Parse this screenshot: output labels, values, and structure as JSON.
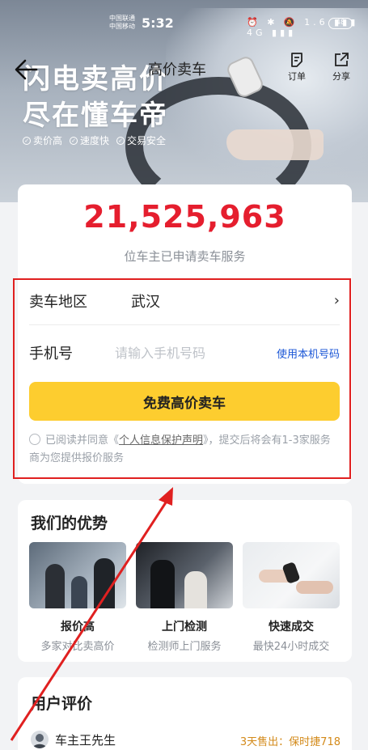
{
  "status_bar": {
    "carrier_1": "中国联通",
    "carrier_2": "中国移动",
    "time": "5:32",
    "icons": "⏰ ✱ 🔕 1.6 ▮▮▮ 4G ▮▮▮",
    "battery": "48"
  },
  "hero": {
    "line1": "闪电卖高价",
    "line2": "尽在懂车帝",
    "badges": [
      "卖价高",
      "速度快",
      "交易安全"
    ]
  },
  "nav": {
    "title": "高价卖车",
    "orders_label": "订单",
    "share_label": "分享"
  },
  "stats": {
    "count": "21,525,963",
    "caption": "位车主已申请卖车服务"
  },
  "form": {
    "region_label": "卖车地区",
    "region_value": "武汉",
    "phone_label": "手机号",
    "phone_placeholder": "请输入手机号码",
    "use_phone": "使用本机号码",
    "submit": "免费高价卖车",
    "agree_prefix": "已阅读并同意《",
    "agree_link": "个人信息保护声明",
    "agree_suffix": "》，提交后将会有1-3家服务商为您提供报价服务"
  },
  "advantages": {
    "title": "我们的优势",
    "items": [
      {
        "name": "报价高",
        "desc": "多家对比卖高价"
      },
      {
        "name": "上门检测",
        "desc": "检测师上门服务"
      },
      {
        "name": "快速成交",
        "desc": "最快24小时成交"
      }
    ]
  },
  "reviews": {
    "title": "用户评价",
    "user": "车主王先生",
    "sold": "3天售出：保时捷718"
  },
  "colors": {
    "accent": "#fdcd2f",
    "count_red": "#e51e2e",
    "annotation_red": "#e02020",
    "link_blue": "#1a56d6"
  }
}
